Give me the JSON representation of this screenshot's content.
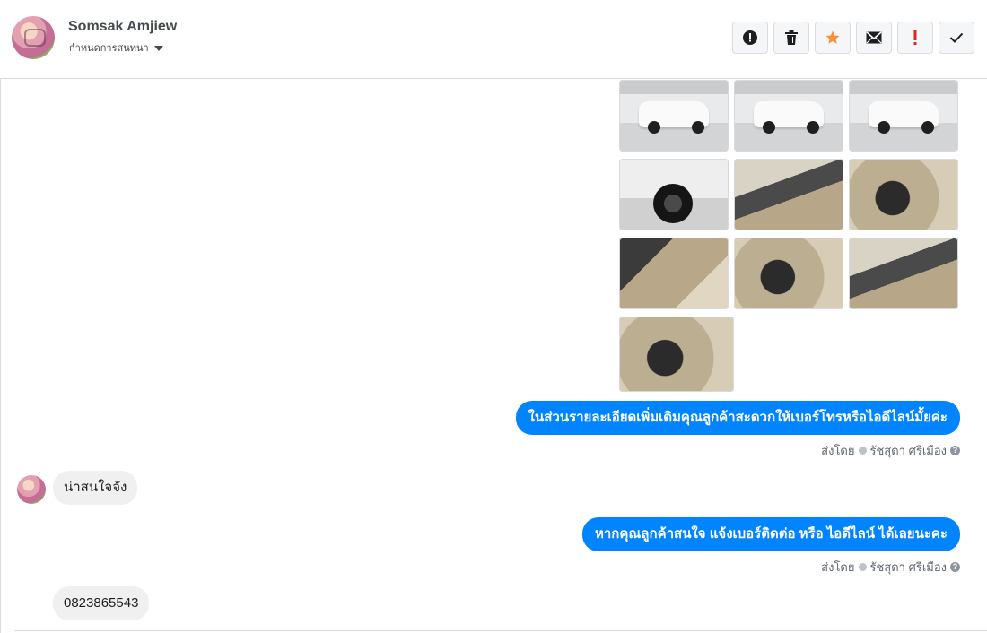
{
  "header": {
    "contact_name": "Somsak Amjiew",
    "assign_label": "กำหนดการสนทนา",
    "actions": [
      {
        "name": "mark-spam-button",
        "icon": "alert-circle-icon"
      },
      {
        "name": "delete-button",
        "icon": "trash-icon"
      },
      {
        "name": "star-button",
        "icon": "star-icon"
      },
      {
        "name": "mark-unread-button",
        "icon": "envelope-icon"
      },
      {
        "name": "follow-up-button",
        "icon": "exclamation-icon"
      },
      {
        "name": "mark-done-button",
        "icon": "checkmark-icon"
      }
    ]
  },
  "colors": {
    "accent": "#0084ff",
    "star": "#f7923a",
    "follow_up": "#e02424"
  },
  "messages": {
    "photos": [
      "car-front-studio",
      "car-side-studio",
      "car-side-studio-2",
      "car-wheel",
      "car-door-interior",
      "car-dashboard",
      "car-gearshift",
      "car-steering-wheel",
      "car-seats",
      "car-cabin-wide"
    ],
    "out1": {
      "text": "ในส่วนรายละเอียดเพิ่มเติมคุณลูกค้าสะดวกให้เบอร์โทรหรือไอดีไลน์มั้ยค่ะ",
      "sent_by_label": "ส่งโดย",
      "sender": "รัชสุดา ศรีเมือง"
    },
    "in1": {
      "text": "น่าสนใจจัง"
    },
    "out2": {
      "text": "หากคุณลูกค้าสนใจ แจ้งเบอร์ติดต่อ หรือ ไอดีไลน์ ได้เลยนะคะ",
      "sent_by_label": "ส่งโดย",
      "sender": "รัชสุดา ศรีเมือง"
    },
    "in2": {
      "text": "0823865543"
    }
  }
}
